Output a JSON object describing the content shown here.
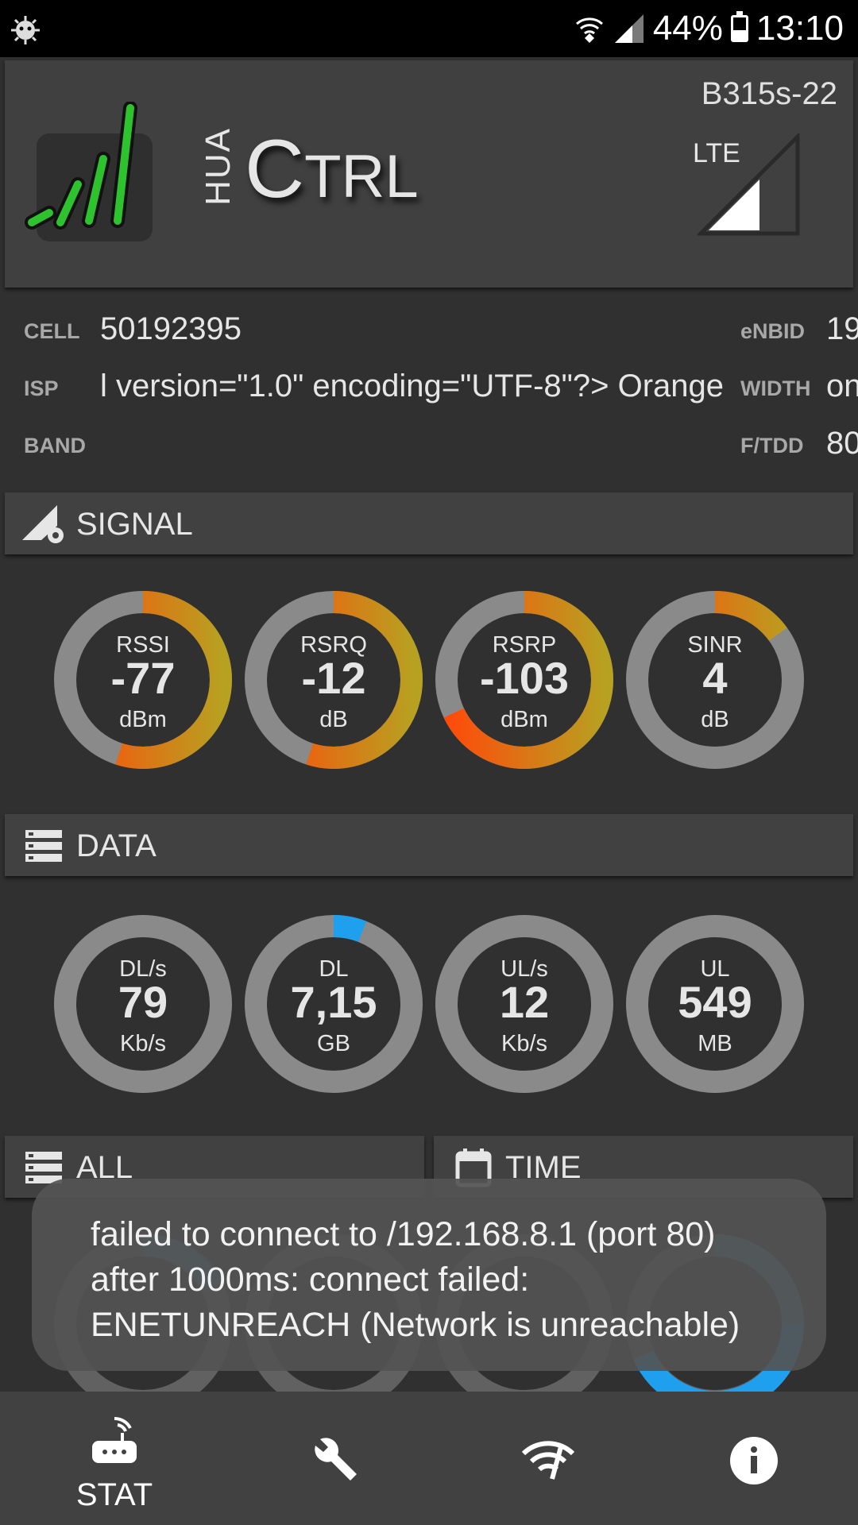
{
  "status_bar": {
    "battery": "44%",
    "time": "13:10",
    "battery_level": 0.44,
    "icons": [
      "android-debug-icon",
      "wifi-icon",
      "cell-signal-icon",
      "battery-icon"
    ]
  },
  "header": {
    "model": "B315s-22",
    "brand_small": "HUA",
    "brand_c": "C",
    "brand_rest": "TRL",
    "network_type": "LTE"
  },
  "info": {
    "cell_label": "CELL",
    "cell_value": "50192395",
    "enbid_label": "eNBID",
    "enbid_value": "19",
    "isp_label": "ISP",
    "isp_value": "l version=\"1.0\" encoding=\"UTF-8\"?> Orange",
    "width_label": "WIDTH",
    "width_value": "on",
    "band_label": "BAND",
    "band_value": "",
    "ftdd_label": "F/TDD",
    "ftdd_value": "80"
  },
  "sections": {
    "signal": "SIGNAL",
    "data": "DATA",
    "all": "ALL",
    "time": "TIME"
  },
  "signal_gauges": [
    {
      "label": "RSSI",
      "value": "-77",
      "unit": "dBm",
      "fill": 0.55
    },
    {
      "label": "RSRQ",
      "value": "-12",
      "unit": "dB",
      "fill": 0.55
    },
    {
      "label": "RSRP",
      "value": "-103",
      "unit": "dBm",
      "fill": 0.68
    },
    {
      "label": "SINR",
      "value": "4",
      "unit": "dB",
      "fill": 0.15
    }
  ],
  "data_gauges": [
    {
      "label": "DL/s",
      "value": "79",
      "unit": "Kb/s",
      "fill": 0
    },
    {
      "label": "DL",
      "value": "7,15",
      "unit": "GB",
      "fill": 0.06
    },
    {
      "label": "UL/s",
      "value": "12",
      "unit": "Kb/s",
      "fill": 0
    },
    {
      "label": "UL",
      "value": "549",
      "unit": "MB",
      "fill": 0
    }
  ],
  "toast": {
    "message": "failed to connect to /192.168.8.1 (port 80) after 1000ms: connect failed: ENETUNREACH (Network is unreachable)"
  },
  "bottom_nav": {
    "stat_label": "STAT",
    "items": [
      "router-icon",
      "wrench-icon",
      "wifi-signal-icon",
      "info-icon"
    ]
  },
  "colors": {
    "background": "#303030",
    "card": "#404040",
    "track": "#8a8a8a",
    "signal_arc_start": "#ff4a0a",
    "signal_arc_end": "#b8a020",
    "data_arc": "#1ea0ee"
  }
}
